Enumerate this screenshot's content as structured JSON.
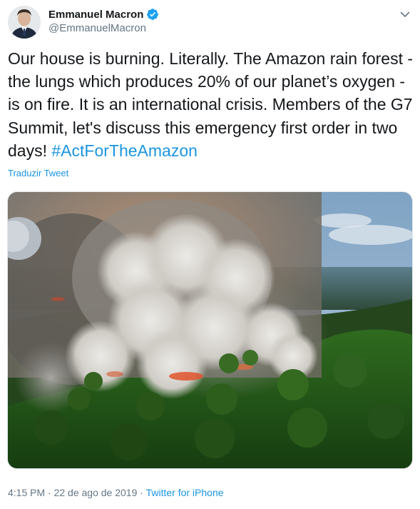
{
  "author": {
    "display_name": "Emmanuel Macron",
    "handle": "@EmmanuelMacron",
    "verified": true
  },
  "tweet": {
    "text_main": "Our house is burning. Literally. The Amazon rain forest - the lungs which produces 20% of our planet’s oxygen - is on fire. It is an international crisis. Members of the G7 Summit, let's discuss this emergency first order in two days! ",
    "hashtag": "#ActForTheAmazon",
    "translate_label": "Traduzir Tweet"
  },
  "meta": {
    "time": "4:15 PM",
    "separator": " · ",
    "date": "22 de ago de 2019",
    "source": "Twitter for iPhone"
  },
  "icons": {
    "verified": "verified-badge-icon",
    "menu": "chevron-down-icon"
  },
  "colors": {
    "link": "#1b95e0",
    "secondary_text": "#657786",
    "primary_text": "#14171a"
  }
}
